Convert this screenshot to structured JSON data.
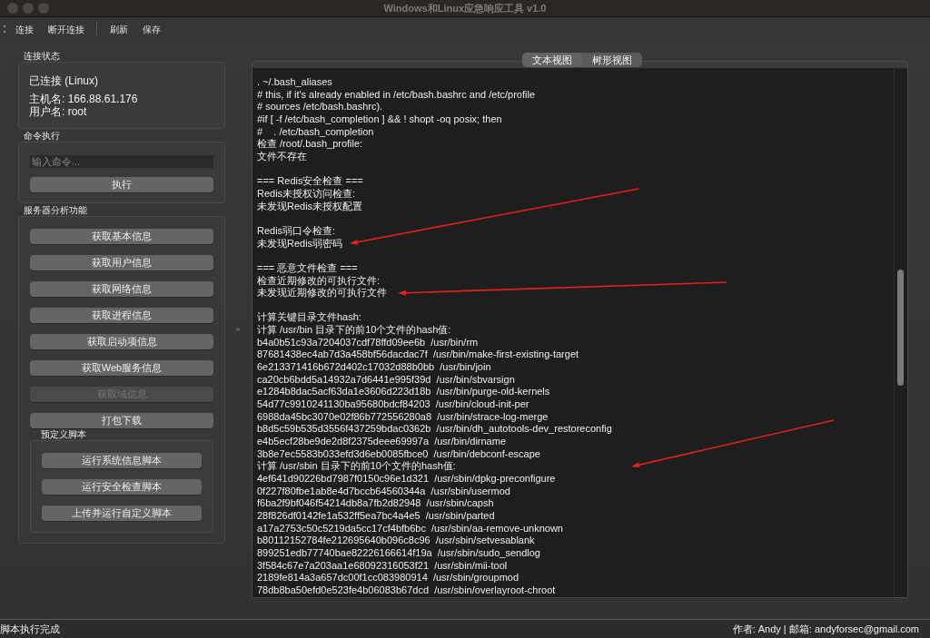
{
  "window": {
    "title": "Windows和Linux应急响应工具 v1.0"
  },
  "toolbar": {
    "groups": [
      [
        "连接",
        "断开连接"
      ],
      [
        "刷新",
        "保存"
      ]
    ]
  },
  "connection": {
    "title": "连接状态",
    "status": "已连接 (Linux)",
    "details": [
      "主机名: 166.88.61.176",
      "用户名: root"
    ]
  },
  "command": {
    "title": "命令执行",
    "input": {
      "placeholder": "输入命令..."
    },
    "button": "执行"
  },
  "analysis": {
    "title": "服务器分析功能",
    "buttons": [
      {
        "label": "获取基本信息",
        "disabled": false
      },
      {
        "label": "获取用户信息",
        "disabled": false
      },
      {
        "label": "获取网络信息",
        "disabled": false
      },
      {
        "label": "获取进程信息",
        "disabled": false
      },
      {
        "label": "获取启动项信息",
        "disabled": false
      },
      {
        "label": "获取Web服务信息",
        "disabled": false
      },
      {
        "label": "获取域信息",
        "disabled": true
      },
      {
        "label": "打包下载",
        "disabled": false
      }
    ],
    "scripts": {
      "title": "预定义脚本",
      "buttons": [
        {
          "label": "运行系统信息脚本",
          "disabled": false
        },
        {
          "label": "运行安全检查脚本",
          "disabled": false
        },
        {
          "label": "上传并运行自定义脚本",
          "disabled": false
        }
      ]
    }
  },
  "view_tabs": [
    {
      "label": "文本视图",
      "selected": true
    },
    {
      "label": "树形视图",
      "selected": false
    }
  ],
  "output": {
    "blocks": [
      [
        ". ~/.bash_aliases",
        "# this, if it's already enabled in /etc/bash.bashrc and /etc/profile",
        "# sources /etc/bash.bashrc).",
        "#if [ -f /etc/bash_completion ] && ! shopt -oq posix; then",
        "#    . /etc/bash_completion",
        "检查 /root/.bash_profile:",
        "文件不存在"
      ],
      [
        "=== Redis安全检查 ===",
        "Redis未授权访问检查:",
        "未发现Redis未授权配置"
      ],
      [
        "Redis弱口令检查:",
        "未发现Redis弱密码"
      ],
      [
        "=== 恶意文件检查 ===",
        "检查近期修改的可执行文件:",
        "未发现近期修改的可执行文件"
      ],
      [
        "计算关键目录文件hash:",
        "计算 /usr/bin 目录下的前10个文件的hash值:",
        "b4a0b51c93a7204037cdf78ffd09ee6b  /usr/bin/rm",
        "87681438ec4ab7d3a458bf56dacdac7f  /usr/bin/make-first-existing-target",
        "6e213371416b672d402c17032d88b0bb  /usr/bin/join",
        "ca20cb6bdd5a14932a7d6441e995f39d  /usr/bin/sbvarsign",
        "e1284b8dac5acf63da1e3606d223d18b  /usr/bin/purge-old-kernels",
        "54d77c9910241130ba95680bdcf84203  /usr/bin/cloud-init-per",
        "6988da45bc3070e02f86b772556280a8  /usr/bin/strace-log-merge",
        "b8d5c59b535d3556f437259bdac0362b  /usr/bin/dh_autotools-dev_restoreconfig",
        "e4b5ecf28be9de2d8f2375deee69997a  /usr/bin/dirname",
        "3b8e7ec5583b033efd3d6eb0085fbce0  /usr/bin/debconf-escape",
        "计算 /usr/sbin 目录下的前10个文件的hash值:",
        "4ef641d90226bd7987f0150c96e1d321  /usr/sbin/dpkg-preconfigure",
        "0f227f80fbe1ab8e4d7bccb64560344a  /usr/sbin/usermod",
        "f6ba2f9bf046f54214db8a7fb2d82948  /usr/sbin/capsh",
        "28f826df0142fe1a532ff5ea7bc4a4e5  /usr/sbin/parted",
        "a17a2753c50c5219da5cc17cf4bfb6bc  /usr/sbin/aa-remove-unknown",
        "b80112152784fe212695640b096c8c96  /usr/sbin/setvesablank",
        "899251edb77740bae82226166614f19a  /usr/sbin/sudo_sendlog",
        "3f584c67e7a203aa1e68092316053f21  /usr/sbin/mii-tool",
        "2189fe814a3a657dc00f1cc083980914  /usr/sbin/groupmod",
        "78db8ba50efd0e523fe4b06083b67dcd  /usr/sbin/overlayroot-chroot"
      ]
    ]
  },
  "annotations": [
    {
      "kind": "arrow"
    },
    {
      "kind": "arrow"
    },
    {
      "kind": "arrow"
    }
  ],
  "status_bar": {
    "message": "脚本执行完成",
    "credits": "作者: Andy | 邮箱: andyforsec@gmail.com"
  }
}
